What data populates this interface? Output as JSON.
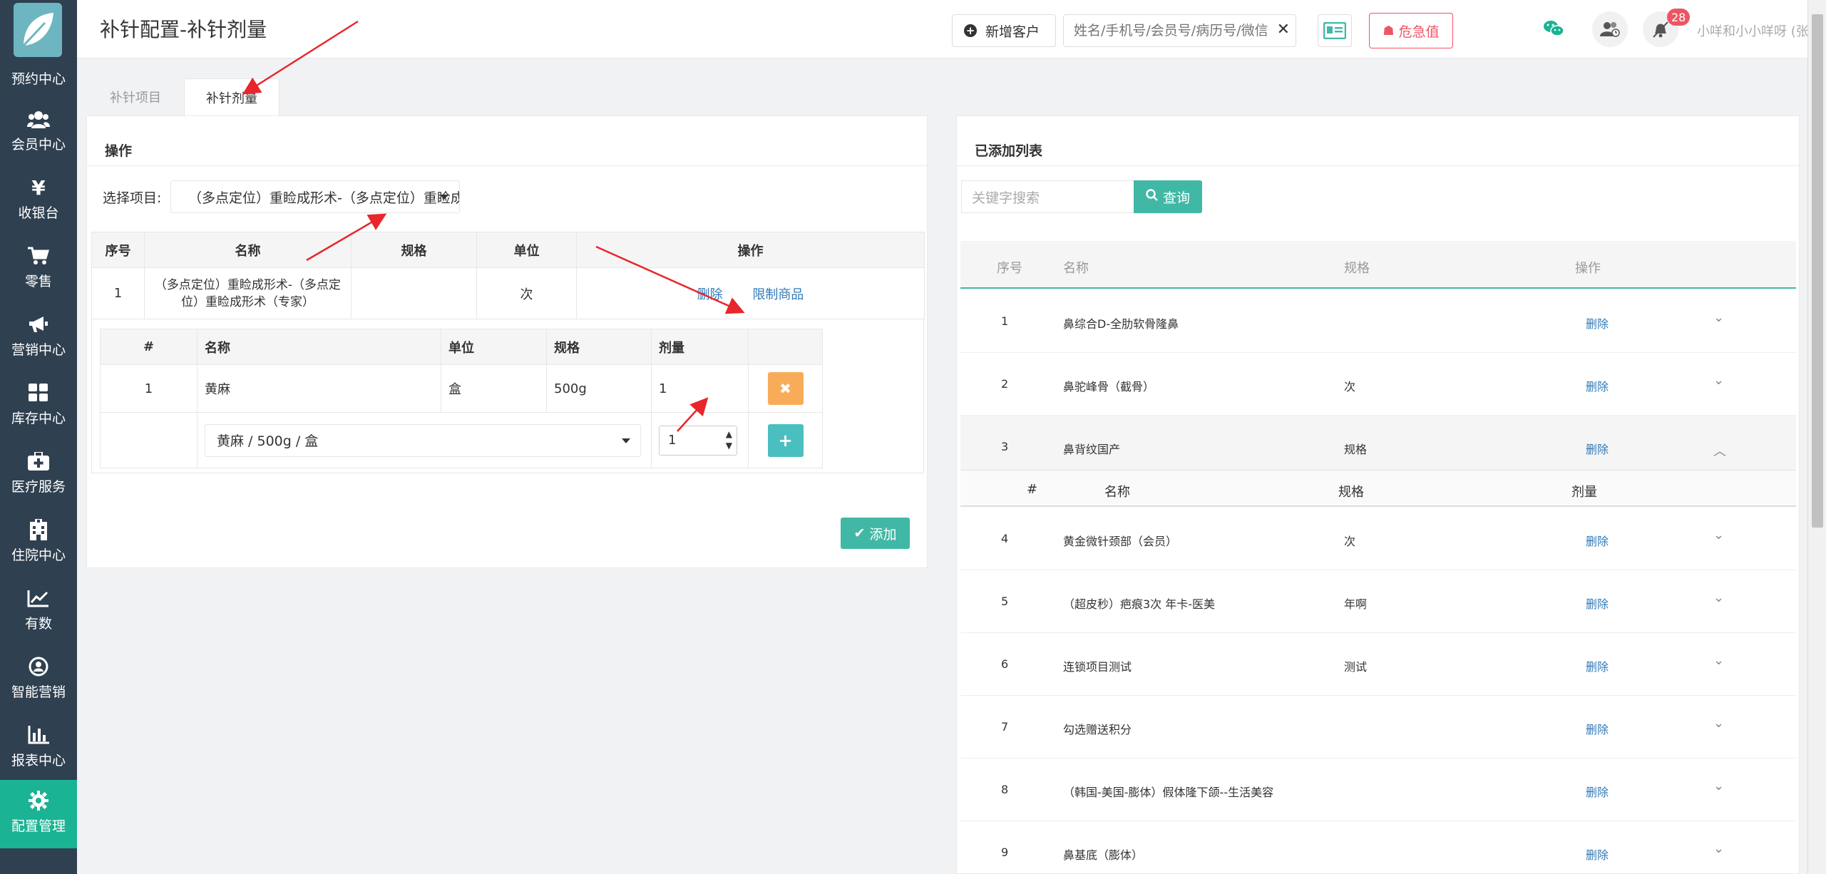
{
  "sidebar": {
    "partial_label": "预约中心",
    "items": [
      {
        "label": "会员中心",
        "icon": "users-icon"
      },
      {
        "label": "收银台",
        "icon": "yen-icon"
      },
      {
        "label": "零售",
        "icon": "cart-icon"
      },
      {
        "label": "营销中心",
        "icon": "megaphone-icon"
      },
      {
        "label": "库存中心",
        "icon": "grid-icon"
      },
      {
        "label": "医疗服务",
        "icon": "medkit-icon"
      },
      {
        "label": "住院中心",
        "icon": "hospital-icon"
      },
      {
        "label": "有数",
        "icon": "line-chart-icon"
      },
      {
        "label": "智能营销",
        "icon": "smart-marketing-icon"
      },
      {
        "label": "报表中心",
        "icon": "bar-chart-icon"
      },
      {
        "label": "配置管理",
        "icon": "gear-icon"
      }
    ],
    "active_color": "#1ab394"
  },
  "header": {
    "title": "补针配置-补针剂量",
    "new_customer": "新增客户",
    "search_placeholder": "姓名/手机号/会员号/病历号/微信号",
    "critical_label": "危急值",
    "notification_count": "28",
    "user": "小咩和小小咩呀 (张江门诊部)"
  },
  "tabs": [
    "补针项目",
    "补针剂量"
  ],
  "left": {
    "panel_title": "操作",
    "select_label": "选择项目:",
    "select_value": "（多点定位）重睑成形术-（多点定位）重睑成形术（专家）",
    "table1": {
      "headers": [
        "序号",
        "名称",
        "规格",
        "单位",
        "操作"
      ],
      "row": {
        "no": "1",
        "name": "（多点定位）重睑成形术-（多点定位）重睑成形术（专家）",
        "spec": "",
        "unit": "次",
        "delete": "删除",
        "limit": "限制商品"
      }
    },
    "table2": {
      "headers": [
        "#",
        "名称",
        "单位",
        "规格",
        "剂量"
      ],
      "row": {
        "no": "1",
        "name": "黄麻",
        "unit": "盒",
        "spec": "500g",
        "dose": "1"
      },
      "input_product": "黄麻 / 500g / 盒",
      "input_dose": "1"
    },
    "add_button": "添加"
  },
  "right": {
    "panel_title": "已添加列表",
    "keyword_placeholder": "关键字搜索",
    "query_button": "查询",
    "headers": [
      "序号",
      "名称",
      "规格",
      "操作"
    ],
    "sub_headers": [
      "#",
      "名称",
      "规格",
      "剂量"
    ],
    "rows": [
      {
        "no": "1",
        "name": "鼻综合D-全肋软骨隆鼻",
        "spec": "",
        "action": "删除"
      },
      {
        "no": "2",
        "name": "鼻驼峰骨（截骨）",
        "spec": "次",
        "action": "删除"
      },
      {
        "no": "3",
        "name": "鼻背纹国产",
        "spec": "规格",
        "action": "删除"
      },
      {
        "no": "4",
        "name": "黄金微针颈部（会员）",
        "spec": "次",
        "action": "删除"
      },
      {
        "no": "5",
        "name": "（超皮秒）疤痕3次 年卡-医美",
        "spec": "年啊",
        "action": "删除"
      },
      {
        "no": "6",
        "name": "连锁项目测试",
        "spec": "测试",
        "action": "删除"
      },
      {
        "no": "7",
        "name": "勾选赠送积分",
        "spec": "",
        "action": "删除"
      },
      {
        "no": "8",
        "name": "（韩国-美国-膨体）假体隆下颌--生活美容",
        "spec": "",
        "action": "删除"
      },
      {
        "no": "9",
        "name": "鼻基底（膨体）",
        "spec": "",
        "action": "删除"
      }
    ]
  },
  "colors": {
    "teal": "#41b8a5",
    "orange": "#f8ac59",
    "danger": "#ed5565",
    "sidebar": "#2f4050",
    "link": "#337ab7"
  }
}
